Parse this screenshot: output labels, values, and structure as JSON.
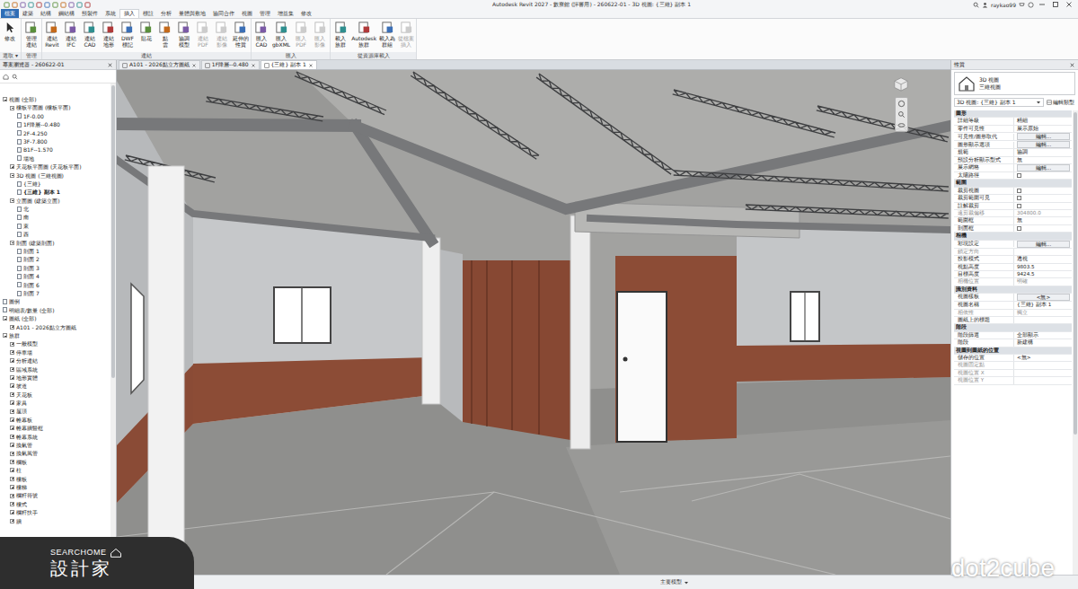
{
  "window": {
    "title": "Autodesk Revit 2027 - 數寮館 (評審用) - 260622-01 - 3D 視圖: {三維} 副本 1",
    "user": "raykao99"
  },
  "ribbon": {
    "tabs": [
      {
        "label": "檔案",
        "kind": "file",
        "selected": false
      },
      {
        "label": "建築",
        "kind": "tab",
        "selected": false
      },
      {
        "label": "結構",
        "kind": "tab",
        "selected": false
      },
      {
        "label": "鋼結構",
        "kind": "tab",
        "selected": false
      },
      {
        "label": "預製件",
        "kind": "tab",
        "selected": false
      },
      {
        "label": "系統",
        "kind": "tab",
        "selected": false
      },
      {
        "label": "插入",
        "kind": "tab",
        "selected": true
      },
      {
        "label": "標註",
        "kind": "tab",
        "selected": false
      },
      {
        "label": "分析",
        "kind": "tab",
        "selected": false
      },
      {
        "label": "量體與敷地",
        "kind": "tab",
        "selected": false
      },
      {
        "label": "協同合作",
        "kind": "tab",
        "selected": false
      },
      {
        "label": "視圖",
        "kind": "tab",
        "selected": false
      },
      {
        "label": "管理",
        "kind": "tab",
        "selected": false
      },
      {
        "label": "增益集",
        "kind": "tab",
        "selected": false
      },
      {
        "label": "修改",
        "kind": "tab",
        "selected": false
      }
    ],
    "panels": [
      {
        "label": "選取 ▾",
        "buttons": [
          {
            "lines": [
              "修改"
            ],
            "disabled": false
          }
        ]
      },
      {
        "label": "管理",
        "buttons": [
          {
            "lines": [
              "管理",
              "連結"
            ],
            "disabled": false
          }
        ]
      },
      {
        "label": "連結",
        "buttons": [
          {
            "lines": [
              "連結",
              "Revit"
            ],
            "disabled": false
          },
          {
            "lines": [
              "連結",
              "IFC"
            ],
            "disabled": false
          },
          {
            "lines": [
              "連結",
              "CAD"
            ],
            "disabled": false
          },
          {
            "lines": [
              "連結",
              "地形"
            ],
            "disabled": false
          },
          {
            "lines": [
              "DWF",
              "標記"
            ],
            "disabled": false
          },
          {
            "lines": [
              "貼花"
            ],
            "disabled": false
          },
          {
            "lines": [
              "點",
              "雲"
            ],
            "disabled": false
          },
          {
            "lines": [
              "協調",
              "模型"
            ],
            "disabled": false
          },
          {
            "lines": [
              "連結",
              "PDF"
            ],
            "disabled": true
          },
          {
            "lines": [
              "連結",
              "影像"
            ],
            "disabled": true
          },
          {
            "lines": [
              "延伸的",
              "性質"
            ],
            "disabled": false
          }
        ]
      },
      {
        "label": "匯入",
        "buttons": [
          {
            "lines": [
              "匯入",
              "CAD"
            ],
            "disabled": false
          },
          {
            "lines": [
              "匯入",
              "gbXML"
            ],
            "disabled": false
          },
          {
            "lines": [
              "匯入",
              "PDF"
            ],
            "disabled": true
          },
          {
            "lines": [
              "匯入",
              "影像"
            ],
            "disabled": true
          }
        ]
      },
      {
        "label": "從資源庫載入",
        "buttons": [
          {
            "lines": [
              "載入",
              "族群"
            ],
            "disabled": false
          },
          {
            "lines": [
              "Autodesk",
              "族群"
            ],
            "disabled": false
          },
          {
            "lines": [
              "載入為",
              "群組"
            ],
            "disabled": false
          },
          {
            "lines": [
              "從檔案",
              "插入"
            ],
            "disabled": true
          }
        ]
      }
    ]
  },
  "browser": {
    "title": "專案瀏覽器 - 260622-01",
    "items": [
      {
        "label": "視圖 (全部)",
        "depth": 0,
        "kind": "group",
        "expanded": true,
        "selected": false
      },
      {
        "label": "樓板平面圖 (樓板平面)",
        "depth": 1,
        "kind": "group",
        "expanded": true,
        "selected": false
      },
      {
        "label": "1F-0.00",
        "depth": 2,
        "kind": "leaf",
        "expanded": false,
        "selected": false
      },
      {
        "label": "1F降層--0.480",
        "depth": 2,
        "kind": "leaf",
        "expanded": false,
        "selected": false
      },
      {
        "label": "2F-4.250",
        "depth": 2,
        "kind": "leaf",
        "expanded": false,
        "selected": false
      },
      {
        "label": "3F-7.800",
        "depth": 2,
        "kind": "leaf",
        "expanded": false,
        "selected": false
      },
      {
        "label": "B1F--1.570",
        "depth": 2,
        "kind": "leaf",
        "expanded": false,
        "selected": false
      },
      {
        "label": "場地",
        "depth": 2,
        "kind": "leaf",
        "expanded": false,
        "selected": false
      },
      {
        "label": "天花板平面圖 (天花板平面)",
        "depth": 1,
        "kind": "group",
        "expanded": false,
        "selected": false
      },
      {
        "label": "3D 視圖 (三維視圖)",
        "depth": 1,
        "kind": "group",
        "expanded": true,
        "selected": false
      },
      {
        "label": "{三維}",
        "depth": 2,
        "kind": "leaf",
        "expanded": false,
        "selected": false
      },
      {
        "label": "{三維} 副本 1",
        "depth": 2,
        "kind": "leaf",
        "expanded": false,
        "selected": true
      },
      {
        "label": "立面圖 (建築立面)",
        "depth": 1,
        "kind": "group",
        "expanded": true,
        "selected": false
      },
      {
        "label": "北",
        "depth": 2,
        "kind": "leaf",
        "expanded": false,
        "selected": false
      },
      {
        "label": "南",
        "depth": 2,
        "kind": "leaf",
        "expanded": false,
        "selected": false
      },
      {
        "label": "東",
        "depth": 2,
        "kind": "leaf",
        "expanded": false,
        "selected": false
      },
      {
        "label": "西",
        "depth": 2,
        "kind": "leaf",
        "expanded": false,
        "selected": false
      },
      {
        "label": "剖面 (建築剖面)",
        "depth": 1,
        "kind": "group",
        "expanded": true,
        "selected": false
      },
      {
        "label": "剖面 1",
        "depth": 2,
        "kind": "leaf",
        "expanded": false,
        "selected": false
      },
      {
        "label": "剖面 2",
        "depth": 2,
        "kind": "leaf",
        "expanded": false,
        "selected": false
      },
      {
        "label": "剖面 3",
        "depth": 2,
        "kind": "leaf",
        "expanded": false,
        "selected": false
      },
      {
        "label": "剖面 4",
        "depth": 2,
        "kind": "leaf",
        "expanded": false,
        "selected": false
      },
      {
        "label": "剖面 6",
        "depth": 2,
        "kind": "leaf",
        "expanded": false,
        "selected": false
      },
      {
        "label": "剖面 7",
        "depth": 2,
        "kind": "leaf",
        "expanded": false,
        "selected": false
      },
      {
        "label": "圖例",
        "depth": 0,
        "kind": "leaf",
        "expanded": false,
        "selected": false
      },
      {
        "label": "明細表/數量 (全部)",
        "depth": 0,
        "kind": "leaf",
        "expanded": false,
        "selected": false
      },
      {
        "label": "圖紙 (全部)",
        "depth": 0,
        "kind": "group",
        "expanded": true,
        "selected": false
      },
      {
        "label": "A101 - 2026點立方圖紙",
        "depth": 1,
        "kind": "group",
        "expanded": false,
        "selected": false
      },
      {
        "label": "族群",
        "depth": 0,
        "kind": "group",
        "expanded": true,
        "selected": false
      },
      {
        "label": "一般模型",
        "depth": 1,
        "kind": "group",
        "expanded": false,
        "selected": false
      },
      {
        "label": "停車場",
        "depth": 1,
        "kind": "group",
        "expanded": false,
        "selected": false
      },
      {
        "label": "分析連結",
        "depth": 1,
        "kind": "group",
        "expanded": false,
        "selected": false
      },
      {
        "label": "區域系統",
        "depth": 1,
        "kind": "group",
        "expanded": false,
        "selected": false
      },
      {
        "label": "地形實體",
        "depth": 1,
        "kind": "group",
        "expanded": false,
        "selected": false
      },
      {
        "label": "坡道",
        "depth": 1,
        "kind": "group",
        "expanded": false,
        "selected": false
      },
      {
        "label": "天花板",
        "depth": 1,
        "kind": "group",
        "expanded": false,
        "selected": false
      },
      {
        "label": "家具",
        "depth": 1,
        "kind": "group",
        "expanded": false,
        "selected": false
      },
      {
        "label": "屋頂",
        "depth": 1,
        "kind": "group",
        "expanded": false,
        "selected": false
      },
      {
        "label": "帷幕板",
        "depth": 1,
        "kind": "group",
        "expanded": false,
        "selected": false
      },
      {
        "label": "帷幕牆豎框",
        "depth": 1,
        "kind": "group",
        "expanded": false,
        "selected": false
      },
      {
        "label": "帷幕系統",
        "depth": 1,
        "kind": "group",
        "expanded": false,
        "selected": false
      },
      {
        "label": "換氣管",
        "depth": 1,
        "kind": "group",
        "expanded": false,
        "selected": false
      },
      {
        "label": "換氣風管",
        "depth": 1,
        "kind": "group",
        "expanded": false,
        "selected": false
      },
      {
        "label": "欄板",
        "depth": 1,
        "kind": "group",
        "expanded": false,
        "selected": false
      },
      {
        "label": "柱",
        "depth": 1,
        "kind": "group",
        "expanded": false,
        "selected": false
      },
      {
        "label": "樓板",
        "depth": 1,
        "kind": "group",
        "expanded": false,
        "selected": false
      },
      {
        "label": "樓梯",
        "depth": 1,
        "kind": "group",
        "expanded": false,
        "selected": false
      },
      {
        "label": "欄杆符號",
        "depth": 1,
        "kind": "group",
        "expanded": false,
        "selected": false
      },
      {
        "label": "樓式",
        "depth": 1,
        "kind": "group",
        "expanded": false,
        "selected": false
      },
      {
        "label": "欄杆扶手",
        "depth": 1,
        "kind": "group",
        "expanded": false,
        "selected": false
      },
      {
        "label": "牆",
        "depth": 1,
        "kind": "group",
        "expanded": false,
        "selected": false
      }
    ]
  },
  "view_tabs": [
    {
      "label": "A101 - 2026點立方圖紙",
      "selected": false
    },
    {
      "label": "1F降層--0.480",
      "selected": false
    },
    {
      "label": "{三維} 副本 1",
      "selected": true
    }
  ],
  "properties": {
    "title": "性質",
    "type_name": "3D 視圖",
    "type_sub": "三維視圖",
    "instance": "3D 視圖: {三維} 副本 1",
    "edit_type": "編輯類型",
    "rows": [
      {
        "kind": "section",
        "label": "圖形",
        "disabled": false,
        "checked": false
      },
      {
        "kind": "text",
        "label": "詳細等級",
        "value": "精細",
        "disabled": false,
        "checked": false
      },
      {
        "kind": "text",
        "label": "零件可見性",
        "value": "展示原始",
        "disabled": false,
        "checked": false
      },
      {
        "kind": "button",
        "label": "可見性/圖形取代",
        "value": "編輯...",
        "disabled": false,
        "checked": false
      },
      {
        "kind": "button",
        "label": "圖形顯示選項",
        "value": "編輯...",
        "disabled": false,
        "checked": false
      },
      {
        "kind": "text",
        "label": "規範",
        "value": "協調",
        "disabled": false,
        "checked": false
      },
      {
        "kind": "text",
        "label": "預設分析顯示型式",
        "value": "無",
        "disabled": false,
        "checked": false
      },
      {
        "kind": "button",
        "label": "展示網格",
        "value": "編輯...",
        "disabled": false,
        "checked": false
      },
      {
        "kind": "check",
        "label": "太陽路徑",
        "disabled": false,
        "checked": false
      },
      {
        "kind": "section",
        "label": "範圍",
        "disabled": false,
        "checked": false
      },
      {
        "kind": "check",
        "label": "裁剪視圖",
        "disabled": false,
        "checked": false
      },
      {
        "kind": "check",
        "label": "裁剪範圍可見",
        "disabled": false,
        "checked": false
      },
      {
        "kind": "check",
        "label": "註解裁剪",
        "disabled": false,
        "checked": false
      },
      {
        "kind": "text",
        "label": "遠剪裁偏移",
        "value": "304800.0",
        "disabled": true,
        "checked": false
      },
      {
        "kind": "text",
        "label": "範圍框",
        "value": "無",
        "disabled": false,
        "checked": false
      },
      {
        "kind": "check",
        "label": "剖面框",
        "disabled": false,
        "checked": false
      },
      {
        "kind": "section",
        "label": "相機",
        "disabled": false,
        "checked": false
      },
      {
        "kind": "button",
        "label": "彩現設定",
        "value": "編輯...",
        "disabled": false,
        "checked": false
      },
      {
        "kind": "text",
        "label": "鎖定方向",
        "value": "",
        "disabled": true,
        "checked": false
      },
      {
        "kind": "text",
        "label": "投影模式",
        "value": "透視",
        "disabled": false,
        "checked": false
      },
      {
        "kind": "text",
        "label": "視點高度",
        "value": "9803.5",
        "disabled": false,
        "checked": false
      },
      {
        "kind": "text",
        "label": "目標高度",
        "value": "9424.5",
        "disabled": false,
        "checked": false
      },
      {
        "kind": "text",
        "label": "相機位置",
        "value": "明確",
        "disabled": true,
        "checked": false
      },
      {
        "kind": "section",
        "label": "識別資料",
        "disabled": false,
        "checked": false
      },
      {
        "kind": "button",
        "label": "視圖樣板",
        "value": "<無>",
        "disabled": false,
        "checked": false
      },
      {
        "kind": "text",
        "label": "視圖名稱",
        "value": "{三維} 副本 1",
        "disabled": false,
        "checked": false
      },
      {
        "kind": "text",
        "label": "相依性",
        "value": "獨立",
        "disabled": true,
        "checked": false
      },
      {
        "kind": "text",
        "label": "圖紙上的標題",
        "value": "",
        "disabled": false,
        "checked": false
      },
      {
        "kind": "section",
        "label": "階段",
        "disabled": false,
        "checked": false
      },
      {
        "kind": "text",
        "label": "階段篩選",
        "value": "全部顯示",
        "disabled": false,
        "checked": false
      },
      {
        "kind": "text",
        "label": "階段",
        "value": "新建構",
        "disabled": false,
        "checked": false
      },
      {
        "kind": "section",
        "label": "視圖到圖紙的位置",
        "disabled": false,
        "checked": false
      },
      {
        "kind": "text",
        "label": "儲存的位置",
        "value": "<無>",
        "disabled": false,
        "checked": false
      },
      {
        "kind": "text",
        "label": "視圖固定點",
        "value": "",
        "disabled": true,
        "checked": false
      },
      {
        "kind": "text",
        "label": "視圖位置 X",
        "value": "",
        "disabled": true,
        "checked": false
      },
      {
        "kind": "text",
        "label": "視圖位置 Y",
        "value": "",
        "disabled": true,
        "checked": false
      }
    ]
  },
  "status_bar": {
    "model": "主要模型"
  },
  "watermarks": {
    "brand_en": "SEARCHOME",
    "brand_zh": "設計家",
    "site": "dot2cube"
  }
}
